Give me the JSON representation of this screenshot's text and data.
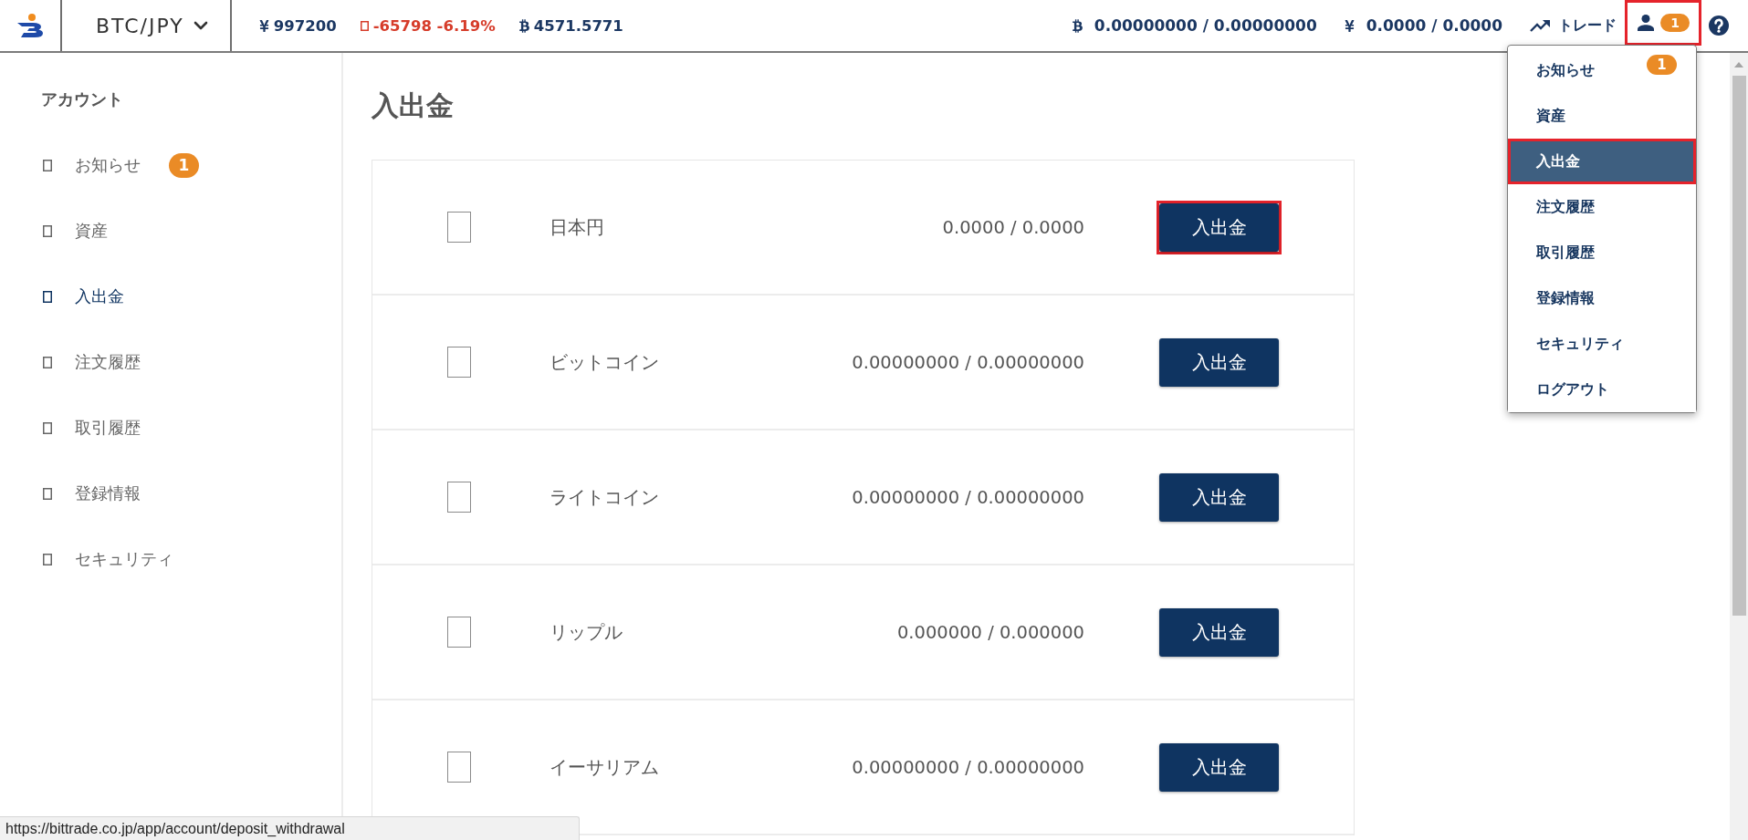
{
  "header": {
    "pair": "BTC/JPY",
    "ticker": [
      {
        "kind": "yen",
        "value": "997200",
        "color": "#1b3762"
      },
      {
        "kind": "square",
        "value": "-65798 -6.19%",
        "color": "#d63c2a"
      },
      {
        "kind": "bitcoin",
        "value": "4571.5771",
        "color": "#1b3762"
      }
    ],
    "balances": [
      {
        "kind": "bitcoin",
        "value": "0.00000000 / 0.00000000"
      },
      {
        "kind": "yen",
        "value": "0.0000 / 0.0000"
      }
    ],
    "trade_link": "トレード",
    "account_button": {
      "badge": "1",
      "highlighted": true,
      "expanded": true
    }
  },
  "account_menu": {
    "items": [
      {
        "label": "お知らせ",
        "badge": "1",
        "selected": false,
        "highlighted": false
      },
      {
        "label": "資産",
        "selected": false,
        "highlighted": false
      },
      {
        "label": "入出金",
        "selected": true,
        "highlighted": true
      },
      {
        "label": "注文履歴",
        "selected": false,
        "highlighted": false
      },
      {
        "label": "取引履歴",
        "selected": false,
        "highlighted": false
      },
      {
        "label": "登録情報",
        "selected": false,
        "highlighted": false
      },
      {
        "label": "セキュリティ",
        "selected": false,
        "highlighted": false
      },
      {
        "label": "ログアウト",
        "selected": false,
        "highlighted": false
      }
    ]
  },
  "sidebar": {
    "title": "アカウント",
    "items": [
      {
        "label": "お知らせ",
        "badge": "1",
        "selected": false
      },
      {
        "label": "資産",
        "selected": false
      },
      {
        "label": "入出金",
        "selected": true
      },
      {
        "label": "注文履歴",
        "selected": false
      },
      {
        "label": "取引履歴",
        "selected": false
      },
      {
        "label": "登録情報",
        "selected": false
      },
      {
        "label": "セキュリティ",
        "selected": false
      }
    ]
  },
  "main": {
    "title": "入出金",
    "rows": [
      {
        "name": "日本円",
        "amount": "0.0000 / 0.0000",
        "button": "入出金",
        "highlighted": true
      },
      {
        "name": "ビットコイン",
        "amount": "0.00000000 / 0.00000000",
        "button": "入出金",
        "highlighted": false
      },
      {
        "name": "ライトコイン",
        "amount": "0.00000000 / 0.00000000",
        "button": "入出金",
        "highlighted": false
      },
      {
        "name": "リップル",
        "amount": "0.000000 / 0.000000",
        "button": "入出金",
        "highlighted": false
      },
      {
        "name": "イーサリアム",
        "amount": "0.00000000 / 0.00000000",
        "button": "入出金",
        "highlighted": false
      }
    ]
  },
  "status_bar": {
    "url": "https://bittrade.co.jp/app/account/deposit_withdrawal"
  }
}
